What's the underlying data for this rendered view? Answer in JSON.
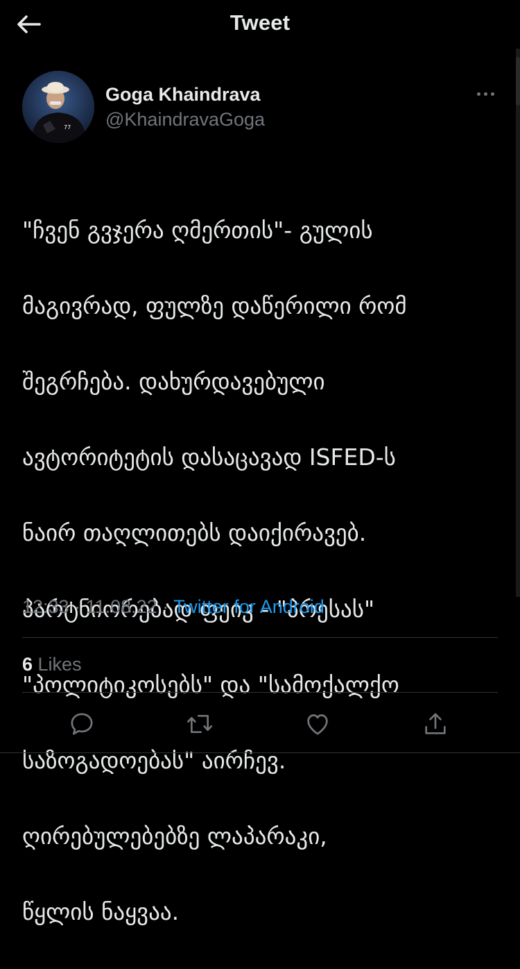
{
  "header": {
    "title": "Tweet",
    "back_icon": "arrow-left-icon"
  },
  "author": {
    "name": "Goga Khaindrava",
    "handle": "@KhaindravaGoga",
    "avatar_icon": "avatar-photo",
    "more_icon": "more-horizontal-icon"
  },
  "tweet": {
    "lines": [
      "\"ჩვენ გვჯერა ღმერთის\"- გულის",
      "მაგივრად, ფულზე დაწერილი რომ",
      "შეგრჩება. დახურდავებული",
      "ავტორიტეტის დასაცავად ISFED-ს",
      "ნაირ თაღლითებს დაიქირავებ.",
      "პარტნიორებად ფეიკ - \"პრესას\"",
      "\"პოლიტიკოსებს\" და \"სამოქალქო",
      "საზოგადოებას\" აირჩევ.",
      "ღირებულებებზე ლაპარაკი,",
      "წყლის ნაყვაა."
    ]
  },
  "meta": {
    "time": "12:33",
    "separator": " · ",
    "date": "11.08.22",
    "source": "Twitter for Android"
  },
  "stats": {
    "likes_count": "6",
    "likes_label": " Likes"
  },
  "actions": [
    {
      "name": "reply-button",
      "icon": "reply-icon"
    },
    {
      "name": "retweet-button",
      "icon": "retweet-icon"
    },
    {
      "name": "like-button",
      "icon": "heart-icon"
    },
    {
      "name": "share-button",
      "icon": "share-icon"
    }
  ],
  "colors": {
    "background": "#000000",
    "text_primary": "#e7e9ea",
    "text_secondary": "#71767b",
    "accent": "#1d9bf0",
    "divider": "#2f3336"
  }
}
